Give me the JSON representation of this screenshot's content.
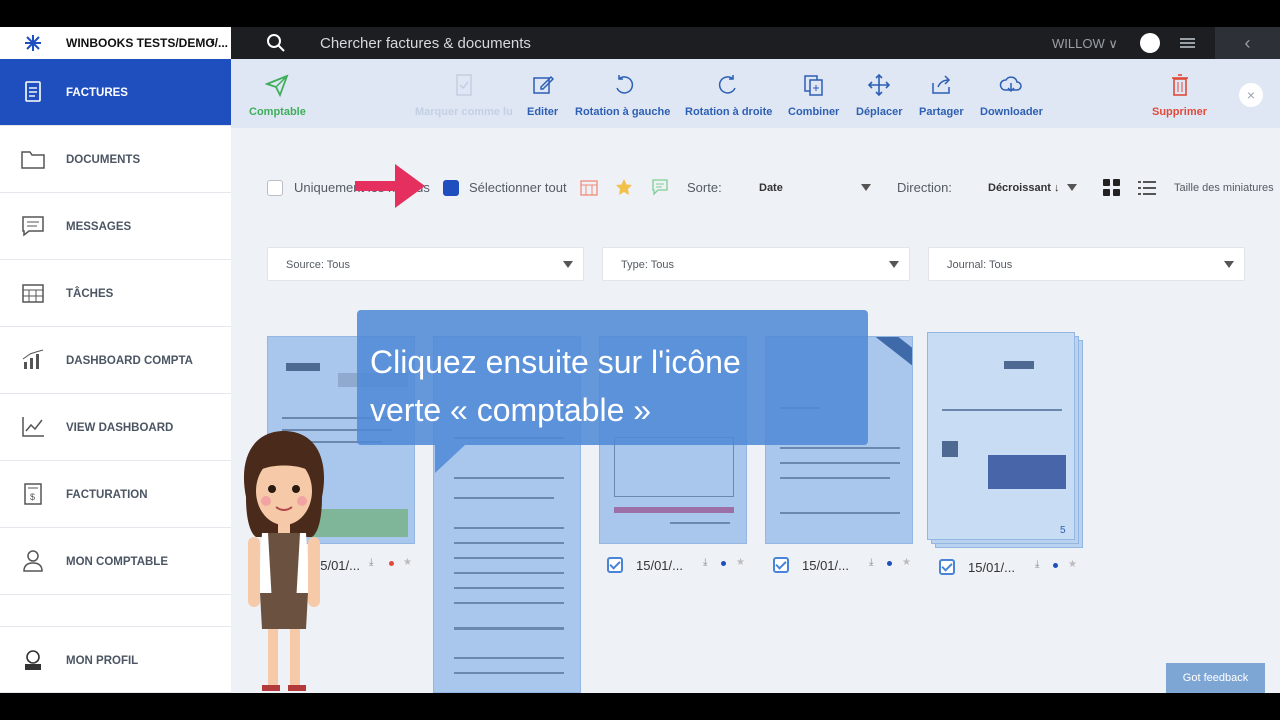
{
  "topbar": {
    "company": "WINBOOKS TESTS/DEMO/...",
    "search_placeholder": "Chercher factures & documents",
    "user": "WILLOW ∨",
    "back_glyph": "‹",
    "collapse_glyph": "‹"
  },
  "sidebar": {
    "items": [
      {
        "label": "FACTURES",
        "icon": "invoice-icon",
        "active": true
      },
      {
        "label": "DOCUMENTS",
        "icon": "folder-icon"
      },
      {
        "label": "MESSAGES",
        "icon": "message-icon"
      },
      {
        "label": "TÂCHES",
        "icon": "calendar-icon"
      },
      {
        "label": "DASHBOARD COMPTA",
        "icon": "bar-chart-icon"
      },
      {
        "label": "VIEW DASHBOARD",
        "icon": "line-chart-icon"
      },
      {
        "label": "FACTURATION",
        "icon": "billing-icon"
      },
      {
        "label": "MON COMPTABLE",
        "icon": "person-icon"
      },
      {
        "label": "MON PROFIL",
        "icon": "profile-icon"
      }
    ]
  },
  "toolbar": {
    "comptable": "Comptable",
    "mark_read": "Marquer comme lu",
    "edit": "Editer",
    "rotate_left": "Rotation à gauche",
    "rotate_right": "Rotation à droite",
    "combine": "Combiner",
    "move": "Déplacer",
    "share": "Partager",
    "download": "Downloader",
    "delete": "Supprimer",
    "close_glyph": "×"
  },
  "filters": {
    "only_label": "Uniquement les non lus",
    "select_all": "Sélectionner tout",
    "sort_label": "Sorte:",
    "sort_value": "Date",
    "direction_label": "Direction:",
    "direction_value": "Décroissant ↓",
    "thumb_size_label": "Taille des miniatures",
    "source": "Source: Tous",
    "type": "Type: Tous",
    "journal": "Journal: Tous"
  },
  "cards": [
    {
      "date": "15/01/..."
    },
    {
      "date": ""
    },
    {
      "date": "15/01/..."
    },
    {
      "date": "15/01/..."
    },
    {
      "date": "15/01/...",
      "badge": "5"
    }
  ],
  "callout": {
    "line1": "Cliquez ensuite sur l'icône",
    "line2": "verte « comptable »"
  },
  "feedback": "Got feedback",
  "colors": {
    "accent": "#1f4fbf",
    "comptable_green": "#3fae5a",
    "delete_red": "#e04a3b",
    "arrow_pink": "#e5305f"
  }
}
